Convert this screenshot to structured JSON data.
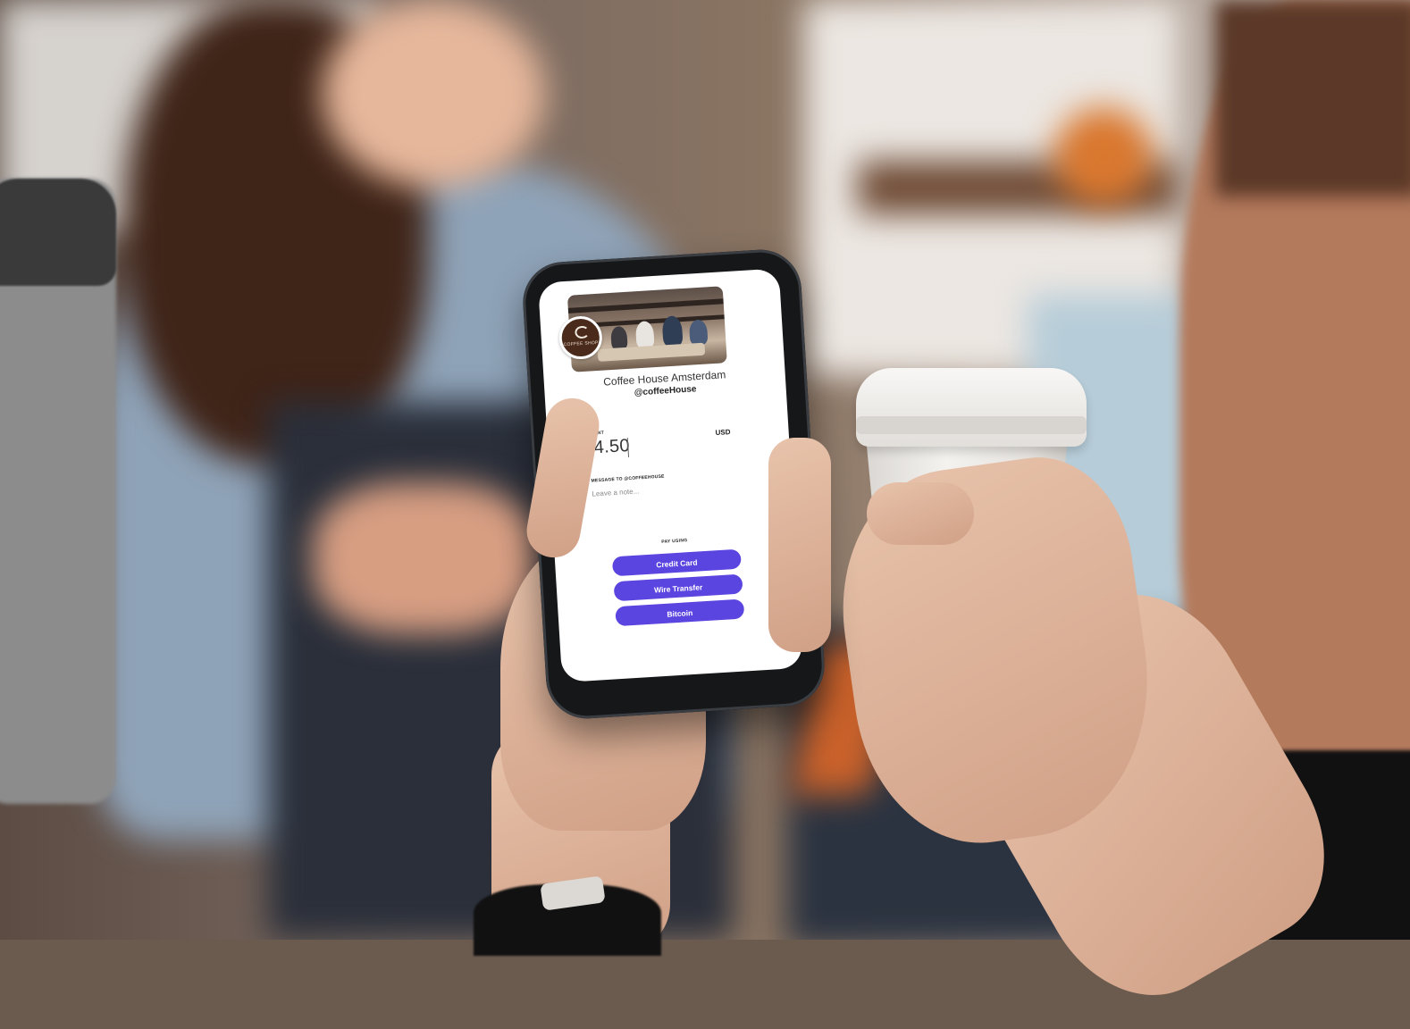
{
  "theme": {
    "accent": "#5b45e0"
  },
  "merchant": {
    "name": "Coffee House Amsterdam",
    "handle": "@coffeeHouse",
    "logo_text": "COFFEE SHOP"
  },
  "payment": {
    "amount_label": "AMOUNT",
    "amount_value": "14.50",
    "currency": "USD",
    "message_label": "MESSAGE TO @COFFEEHOUSE",
    "message_placeholder": "Leave a note...",
    "pay_using_label": "PAY USING",
    "options": [
      {
        "label": "Credit Card"
      },
      {
        "label": "Wire Transfer"
      },
      {
        "label": "Bitcoin"
      }
    ]
  }
}
